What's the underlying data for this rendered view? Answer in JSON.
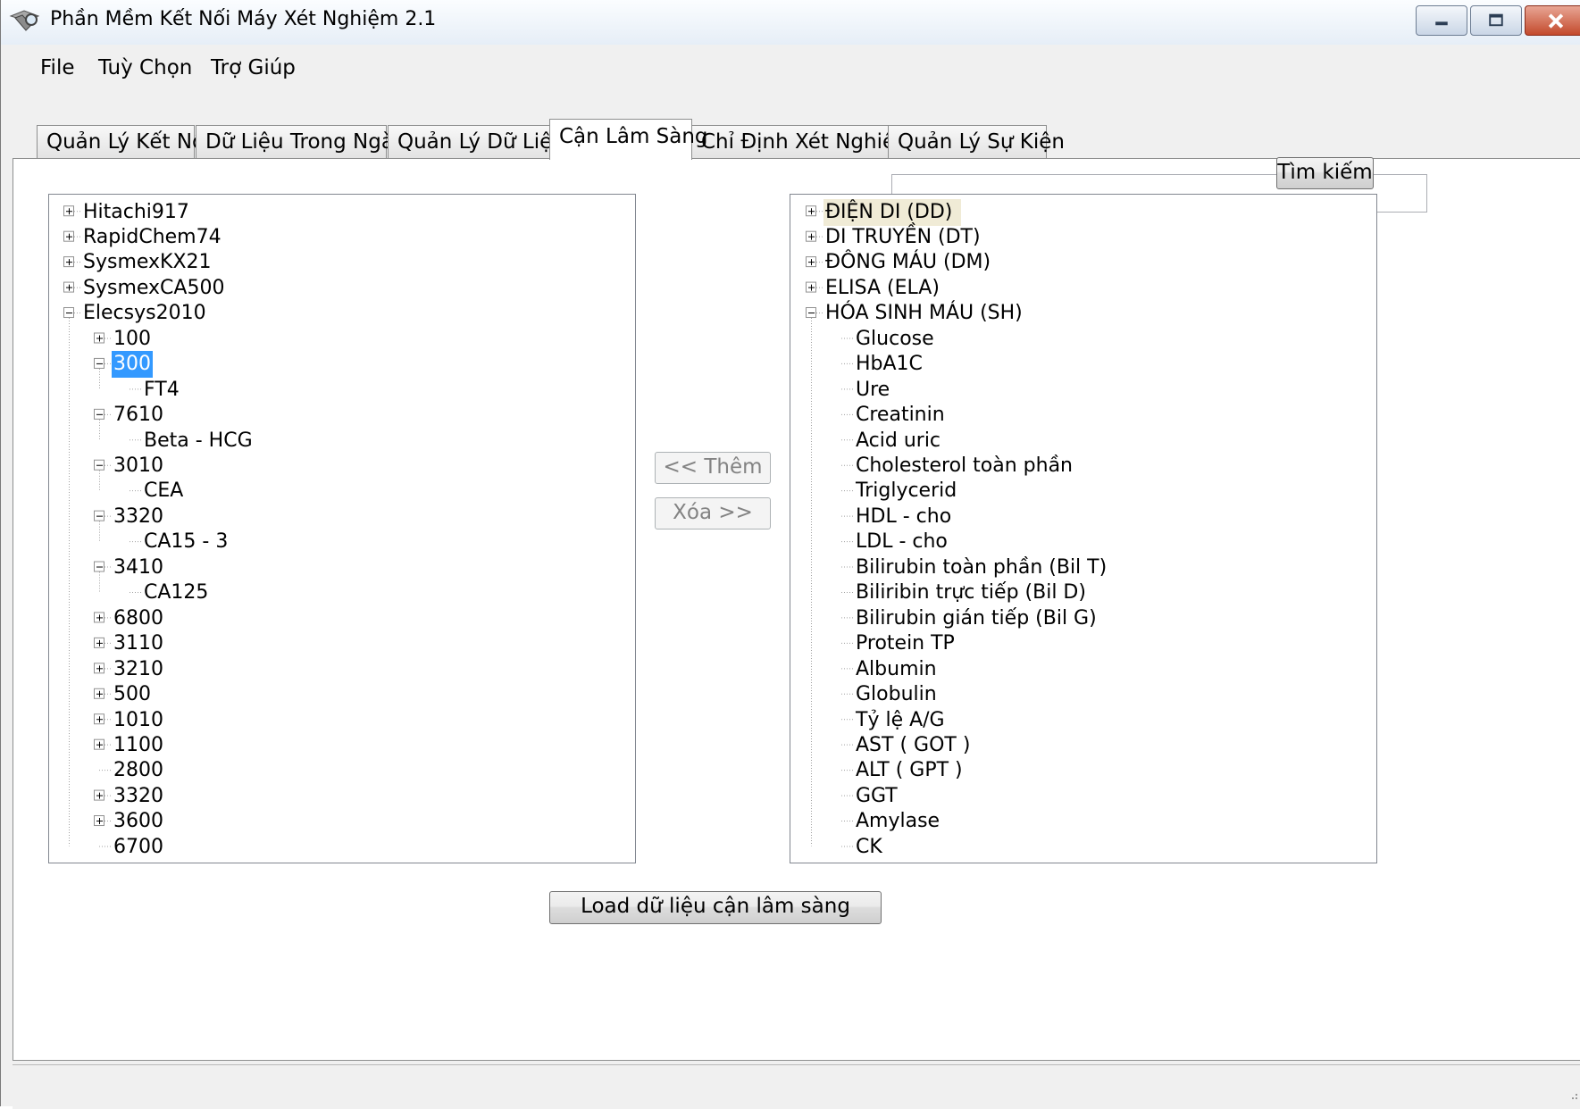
{
  "window": {
    "title": "Phần Mềm Kết Nối Máy Xét Nghiệm 2.1",
    "controls": [
      "minimize",
      "maximize",
      "close"
    ]
  },
  "menu": [
    "File",
    "Tuỳ Chọn",
    "Trợ Giúp"
  ],
  "tabs": [
    {
      "label": "Quản Lý Kết Nối",
      "active": false
    },
    {
      "label": "Dữ Liệu Trong Ngày",
      "active": false
    },
    {
      "label": "Quản Lý Dữ Liệu",
      "active": false
    },
    {
      "label": "Cận Lâm Sàng",
      "active": true
    },
    {
      "label": "Chỉ Định Xét Nghiệm",
      "active": false
    },
    {
      "label": "Quản Lý Sự Kiện",
      "active": false
    }
  ],
  "search": {
    "value": "",
    "button": "Tìm kiếm"
  },
  "buttons": {
    "add": "<< Thêm",
    "remove": "Xóa >>",
    "load": "Load dữ liệu cận lâm sàng"
  },
  "left_tree": [
    {
      "label": "Hitachi917",
      "level": 0,
      "toggle": "plus"
    },
    {
      "label": "RapidChem74",
      "level": 0,
      "toggle": "plus"
    },
    {
      "label": "SysmexKX21",
      "level": 0,
      "toggle": "plus"
    },
    {
      "label": "SysmexCA500",
      "level": 0,
      "toggle": "plus"
    },
    {
      "label": "Elecsys2010",
      "level": 0,
      "toggle": "minus"
    },
    {
      "label": "100",
      "level": 1,
      "toggle": "plus"
    },
    {
      "label": "300",
      "level": 1,
      "toggle": "minus",
      "selected": true
    },
    {
      "label": "FT4",
      "level": 2,
      "toggle": "none"
    },
    {
      "label": "7610",
      "level": 1,
      "toggle": "minus"
    },
    {
      "label": "Beta - HCG",
      "level": 2,
      "toggle": "none"
    },
    {
      "label": "3010",
      "level": 1,
      "toggle": "minus"
    },
    {
      "label": "CEA",
      "level": 2,
      "toggle": "none"
    },
    {
      "label": "3320",
      "level": 1,
      "toggle": "minus"
    },
    {
      "label": "CA15 - 3",
      "level": 2,
      "toggle": "none"
    },
    {
      "label": "3410",
      "level": 1,
      "toggle": "minus"
    },
    {
      "label": "CA125",
      "level": 2,
      "toggle": "none"
    },
    {
      "label": "6800",
      "level": 1,
      "toggle": "plus"
    },
    {
      "label": "3110",
      "level": 1,
      "toggle": "plus"
    },
    {
      "label": "3210",
      "level": 1,
      "toggle": "plus"
    },
    {
      "label": "500",
      "level": 1,
      "toggle": "plus"
    },
    {
      "label": "1010",
      "level": 1,
      "toggle": "plus"
    },
    {
      "label": "1100",
      "level": 1,
      "toggle": "plus"
    },
    {
      "label": "2800",
      "level": 1,
      "toggle": "none"
    },
    {
      "label": "3320",
      "level": 1,
      "toggle": "plus"
    },
    {
      "label": "3600",
      "level": 1,
      "toggle": "plus"
    },
    {
      "label": "6700",
      "level": 1,
      "toggle": "none"
    }
  ],
  "right_tree": [
    {
      "label": "ĐIỆN DI (DD)",
      "level": 0,
      "toggle": "plus",
      "highlight": true
    },
    {
      "label": "DI TRUYỀN (DT)",
      "level": 0,
      "toggle": "plus"
    },
    {
      "label": "ĐÔNG MÁU  (DM)",
      "level": 0,
      "toggle": "plus"
    },
    {
      "label": "ELISA (ELA)",
      "level": 0,
      "toggle": "plus"
    },
    {
      "label": "HÓA SINH MÁU (SH)",
      "level": 0,
      "toggle": "minus"
    },
    {
      "label": "Glucose",
      "level": 1,
      "toggle": "none"
    },
    {
      "label": "HbA1C",
      "level": 1,
      "toggle": "none"
    },
    {
      "label": "Ure",
      "level": 1,
      "toggle": "none"
    },
    {
      "label": "Creatinin",
      "level": 1,
      "toggle": "none"
    },
    {
      "label": "Acid uric",
      "level": 1,
      "toggle": "none"
    },
    {
      "label": "Cholesterol toàn phần",
      "level": 1,
      "toggle": "none"
    },
    {
      "label": "Triglycerid",
      "level": 1,
      "toggle": "none"
    },
    {
      "label": "HDL - cho",
      "level": 1,
      "toggle": "none"
    },
    {
      "label": "LDL - cho",
      "level": 1,
      "toggle": "none"
    },
    {
      "label": "Bilirubin toàn phần (Bil T)",
      "level": 1,
      "toggle": "none"
    },
    {
      "label": "Biliribin trực tiếp (Bil D)",
      "level": 1,
      "toggle": "none"
    },
    {
      "label": "Bilirubin gián tiếp (Bil G)",
      "level": 1,
      "toggle": "none"
    },
    {
      "label": "Protein TP",
      "level": 1,
      "toggle": "none"
    },
    {
      "label": "Albumin",
      "level": 1,
      "toggle": "none"
    },
    {
      "label": "Globulin",
      "level": 1,
      "toggle": "none"
    },
    {
      "label": "Tỷ lệ A/G",
      "level": 1,
      "toggle": "none"
    },
    {
      "label": "AST ( GOT )",
      "level": 1,
      "toggle": "none"
    },
    {
      "label": "ALT ( GPT )",
      "level": 1,
      "toggle": "none"
    },
    {
      "label": "GGT",
      "level": 1,
      "toggle": "none"
    },
    {
      "label": "Amylase",
      "level": 1,
      "toggle": "none"
    },
    {
      "label": "CK",
      "level": 1,
      "toggle": "none"
    }
  ],
  "colors": {
    "selection": "#3399ff",
    "highlight": "#f0ebd6",
    "close_button": "#c34a2c"
  }
}
